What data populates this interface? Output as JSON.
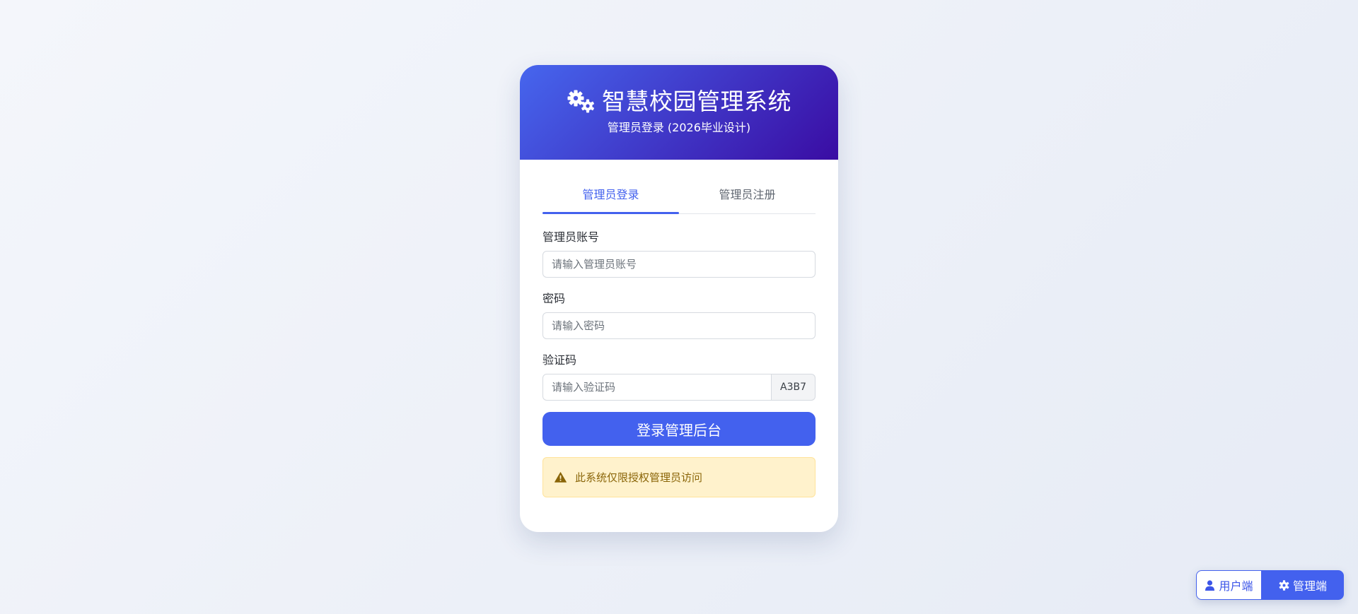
{
  "header": {
    "icon": "gears-icon",
    "title": "智慧校园管理系统",
    "subtitle": "管理员登录 (2026毕业设计)"
  },
  "tabs": [
    {
      "label": "管理员登录",
      "active": true
    },
    {
      "label": "管理员注册",
      "active": false
    }
  ],
  "form": {
    "account": {
      "label": "管理员账号",
      "placeholder": "请输入管理员账号",
      "value": ""
    },
    "password": {
      "label": "密码",
      "placeholder": "请输入密码",
      "value": ""
    },
    "captcha": {
      "label": "验证码",
      "placeholder": "请输入验证码",
      "value": "",
      "code": "A3B7"
    },
    "submit_label": "登录管理后台"
  },
  "alert": {
    "icon": "warning-icon",
    "text": "此系统仅限授权管理员访问"
  },
  "switcher": {
    "user_label": "用户端",
    "user_icon": "user-icon",
    "admin_label": "管理端",
    "admin_icon": "gear-icon",
    "active": "admin"
  },
  "colors": {
    "accent": "#4361ee",
    "header_gradient_start": "#4666ee",
    "header_gradient_end": "#3a0ca3",
    "alert_background": "#fff2cc",
    "alert_text": "#8a6508"
  }
}
